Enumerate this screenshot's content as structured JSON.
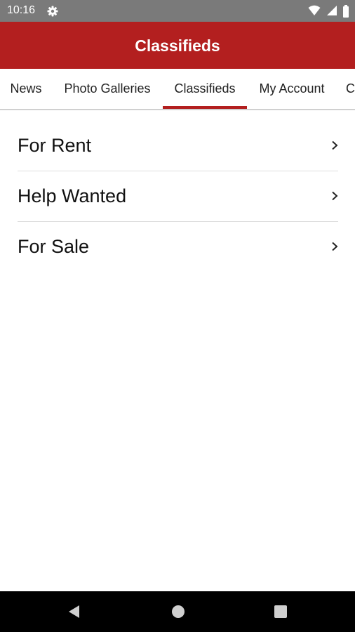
{
  "status_bar": {
    "time": "10:16",
    "icons": [
      "settings-icon",
      "wifi-icon",
      "signal-icon",
      "battery-icon"
    ]
  },
  "app_bar": {
    "title": "Classifieds",
    "color": "#b31f1f"
  },
  "tabs": [
    {
      "label": "News",
      "selected": false
    },
    {
      "label": "Photo Galleries",
      "selected": false
    },
    {
      "label": "Classifieds",
      "selected": true
    },
    {
      "label": "My Account",
      "selected": false
    },
    {
      "label": "C",
      "selected": false
    }
  ],
  "categories": [
    {
      "label": "For Rent",
      "icon": "chevron-right-icon"
    },
    {
      "label": "Help Wanted",
      "icon": "chevron-right-icon"
    },
    {
      "label": "For Sale",
      "icon": "chevron-right-icon"
    }
  ],
  "nav_bar": {
    "buttons": [
      "back-icon",
      "home-icon",
      "recents-icon"
    ]
  }
}
